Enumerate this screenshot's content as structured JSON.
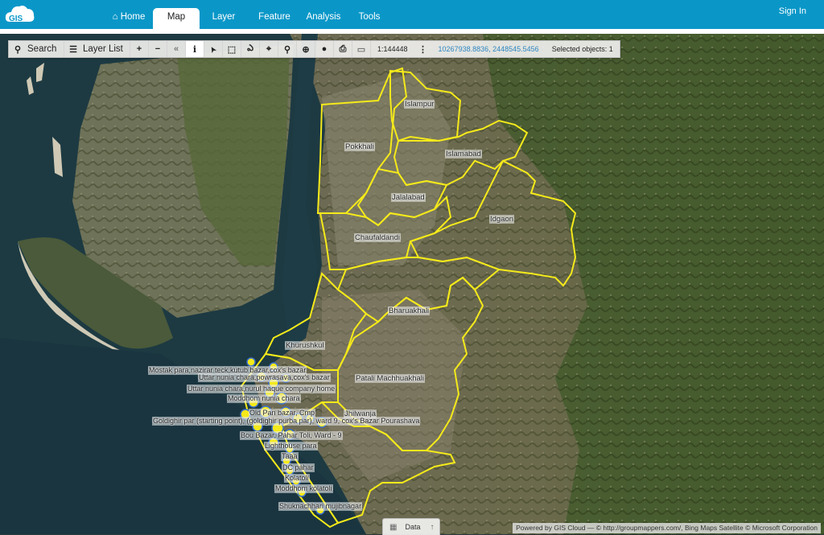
{
  "app": {
    "logo_text": "GIS",
    "nav": [
      {
        "label": "Home",
        "icon": "home-icon",
        "active": false
      },
      {
        "label": "Map",
        "active": true
      },
      {
        "label": "Layer",
        "active": false
      },
      {
        "label": "Feature",
        "active": false
      },
      {
        "label": "Analysis",
        "active": false
      },
      {
        "label": "Tools",
        "active": false
      }
    ],
    "sign_in": "Sign In"
  },
  "toolbar": {
    "search_label": "Search",
    "layer_list_label": "Layer List",
    "tools": [
      {
        "name": "zoom-in-icon",
        "glyph": "+"
      },
      {
        "name": "zoom-out-icon",
        "glyph": "−"
      },
      {
        "name": "collapse-icon",
        "glyph": "«"
      },
      {
        "name": "info-icon",
        "glyph": "i",
        "active": true
      },
      {
        "name": "select-pointer-icon",
        "glyph": "➤"
      },
      {
        "name": "box-select-icon",
        "glyph": "⬚"
      },
      {
        "name": "freehand-icon",
        "glyph": "ఎ"
      },
      {
        "name": "locate-icon",
        "glyph": "⌖"
      },
      {
        "name": "pin-icon",
        "glyph": "⚲"
      },
      {
        "name": "zoom-extent-icon",
        "glyph": "⊕"
      },
      {
        "name": "globe-icon",
        "glyph": "●"
      },
      {
        "name": "print-icon",
        "glyph": "⎙"
      },
      {
        "name": "measure-icon",
        "glyph": "▭"
      }
    ],
    "scale": "1:144448",
    "more_glyph": "⋮",
    "coordinates": "10267938.8836, 2448545.5456",
    "selected_objects": "Selected objects: 1"
  },
  "map": {
    "boundary_color": "#f5ea1a",
    "point_fill": "#f5ea1a",
    "point_stroke": "#3a6fd0",
    "area_labels": [
      "Islampur",
      "Pokkhali",
      "Islamabad",
      "Jalalabad",
      "Idgaon",
      "Chaufaldandi",
      "Bharuakhali",
      "Khurushkul",
      "Patali Machhuakhali",
      "Jhilwanja"
    ],
    "point_labels": [
      "Mostak para,nazirar teck,kutub bazar,cox's bazar",
      "Uttar nunia chara,powrasava,cox's bazar",
      "Uttar nunia chara,nurul haque company home",
      "Moddhom nunia chara",
      "Old Pan bazar, Cmp",
      "Goldighir par (starting point), (goldighir purba par), ward 9, cox's Bazar Pourashava",
      "Bou Bazar, Pahar Toli, Ward - 9",
      "Lighthouse para",
      "Taaa",
      "DC pahar",
      "Kolatoli",
      "Moddhom kolatoli",
      "Shuknachhari mujibnagar"
    ]
  },
  "data_panel": {
    "label": "Data"
  },
  "attribution": "Powered by GIS Cloud — © http://groupmappers.com/, Bing Maps Satellite © Microsoft Corporation"
}
